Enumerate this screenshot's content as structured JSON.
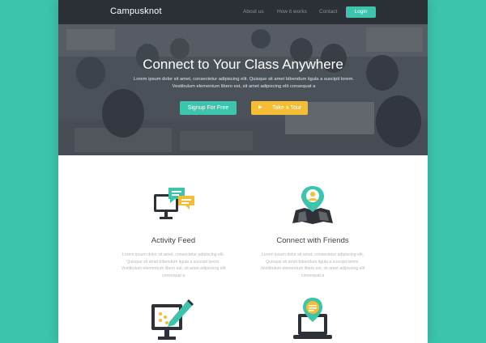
{
  "nav": {
    "brand": "Campusknot",
    "links": [
      "About us",
      "How it works",
      "Contact"
    ],
    "login_label": "Login"
  },
  "hero": {
    "title": "Connect to Your Class Anywhere",
    "description": "Lorem ipsum dolor sit amet, consectetur adipiscing elit. Quisque sit amet bibendum ligula a suscipit lorem. Vestibulum elementum libero est, sit amet adipiscing elit consequat a",
    "signup_label": "Signup For Free",
    "tour_label": "Take a Tour"
  },
  "features": [
    {
      "title": "Activity Feed",
      "description": "Lorem ipsum dolor sit amet, consectetur adipiscing elit. Quisque sit amet bibendum ligula a suscipit lorem. Vestibulum elementum libero est, sit amet adipiscing elit consequat a",
      "icon": "monitor-chat-icon"
    },
    {
      "title": "Connect with Friends",
      "description": "Lorem ipsum dolor sit amet, consectetur adipiscing elit. Quisque sit amet bibendum ligula a suscipit lorem. Vestibulum elementum libero est, sit amet adipiscing elit consequat a",
      "icon": "map-pin-user-icon"
    },
    {
      "icon": "monitor-pencil-icon"
    },
    {
      "icon": "laptop-pin-icon"
    }
  ],
  "colors": {
    "accent": "#3cc4ac",
    "navbar": "#2b2f36",
    "tour_button": "#f4bd33",
    "icon_dark": "#2e3238"
  }
}
